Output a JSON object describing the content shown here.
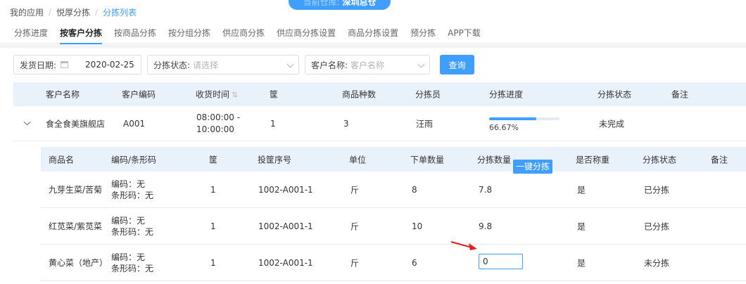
{
  "breadcrumb": [
    "我的应用",
    "悦厚分拣",
    "分拣列表"
  ],
  "warehouse": {
    "label": "当前仓库:",
    "value": "深圳总仓"
  },
  "tabs": [
    "分拣进度",
    "按客户分拣",
    "按商品分拣",
    "按分组分拣",
    "供应商分拣",
    "供应商分拣设置",
    "商品分拣设置",
    "预分拣",
    "APP下载"
  ],
  "active_tab": "按客户分拣",
  "filters": {
    "date_label": "发货日期:",
    "date_value": "2020-02-25",
    "status_label": "分拣状态:",
    "status_placeholder": "请选择",
    "customer_label": "客户名称:",
    "customer_placeholder": "客户名称",
    "query_button": "查询"
  },
  "main_table": {
    "headers": [
      "客户名称",
      "客户编码",
      "收货时间",
      "筐",
      "商品种数",
      "分拣员",
      "分拣进度",
      "分拣状态",
      "备注"
    ],
    "row": {
      "customer_name": "食全食美旗舰店",
      "customer_code": "A001",
      "time": "08:00:00 - 10:00:00",
      "basket": "1",
      "kinds": "3",
      "sorter": "汪雨",
      "progress_text": "66.67%",
      "progress_value": 0.6667,
      "status": "未完成",
      "remark": ""
    }
  },
  "sub_table": {
    "headers": [
      "商品名",
      "编码/条形码",
      "筐",
      "投筐序号",
      "单位",
      "下单数量",
      "分拣数量",
      "是否称重",
      "分拣状态",
      "备注"
    ],
    "one_key_button": "一键分拣",
    "rows": [
      {
        "name": "九芽生菜/苦菊",
        "code": "编码：无",
        "barcode": "条形码：无",
        "basket": "1",
        "seq": "1002-A001-1",
        "unit": "斤",
        "order_qty": "8",
        "sort_qty": "7.8",
        "weighed": "是",
        "status": "已分拣",
        "remark": ""
      },
      {
        "name": "红苋菜/紫苋菜",
        "code": "编码：无",
        "barcode": "条形码：无",
        "basket": "1",
        "seq": "1002-A001-1",
        "unit": "斤",
        "order_qty": "10",
        "sort_qty": "9.8",
        "weighed": "是",
        "status": "已分拣",
        "remark": ""
      },
      {
        "name": "黄心菜（地产）",
        "code": "编码：无",
        "barcode": "条形码：无",
        "basket": "1",
        "seq": "1002-A001-1",
        "unit": "斤",
        "order_qty": "6",
        "sort_qty": "0",
        "weighed": "是",
        "status": "未分拣",
        "remark": ""
      }
    ]
  },
  "colors": {
    "accent": "#409eff",
    "header_bg": "#e9f1fb",
    "arrow": "#e02020"
  }
}
